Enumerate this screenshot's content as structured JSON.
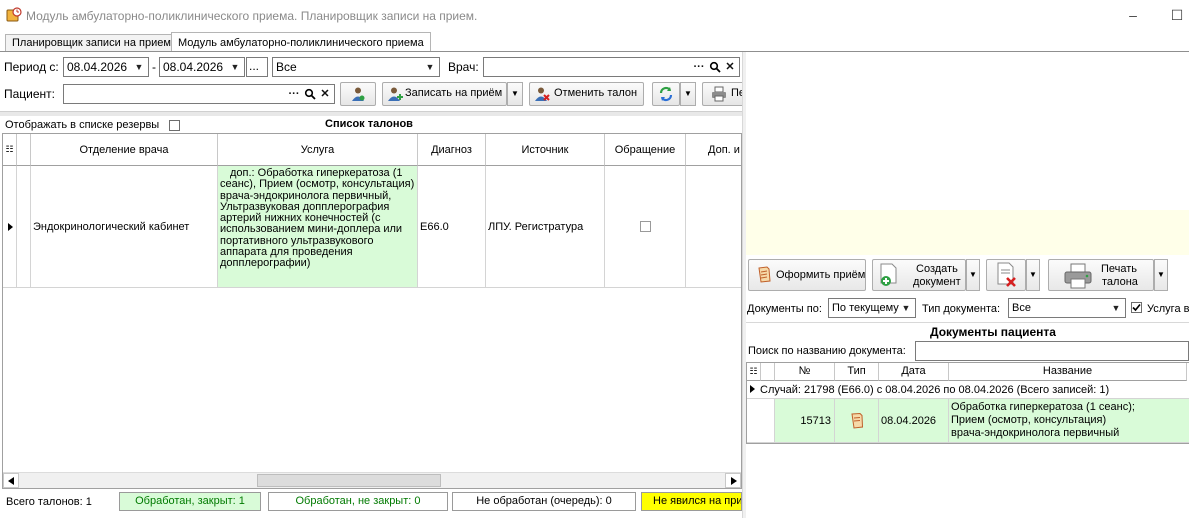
{
  "window": {
    "title": "Модуль амбулаторно-поликлинического приема. Планировщик записи на прием.",
    "minimize_glyph": "–",
    "maximize_glyph": "☐"
  },
  "tabs": [
    {
      "label": "Планировщик записи на прием",
      "active": false
    },
    {
      "label": "Модуль амбулаторно-поликлинического приема",
      "active": true
    }
  ],
  "filters": {
    "period_label": "Период с:",
    "date_from": "08.04.2026",
    "date_sep": "-",
    "date_to": "08.04.2026",
    "ellipsis": "...",
    "status_value": "Все",
    "doctor_label": "Врач:",
    "doctor_value": "",
    "patient_label": "Пациент:",
    "patient_value": ""
  },
  "toolbar": {
    "book_label": "Записать на приём",
    "cancel_label": "Отменить талон",
    "print_label": "Пе"
  },
  "list": {
    "reserves_label": "Отображать в списке резервы",
    "title": "Список талонов",
    "columns": [
      "Отделение врача",
      "Услуга",
      "Диагноз",
      "Источник",
      "Обращение",
      "Доп. и"
    ],
    "rows": [
      {
        "department": "Эндокринологический кабинет",
        "service": "доп.: Обработка гиперкератоза (1 сеанс), Прием (осмотр, консультация) врача-эндокринолога первичный, Ультразвуковая допплерография артерий нижних конечностей (с использованием мини-доплера или портативного ультразвукового аппарата для проведения допплерографии)",
        "diagnosis": "E66.0",
        "source": "ЛПУ. Регистратура"
      }
    ]
  },
  "statusbar": {
    "total": "Всего талонов: 1",
    "processed_closed": "Обработан, закрыт: 1",
    "processed_open": "Обработан, не закрыт: 0",
    "not_processed": "Не обработан (очередь): 0",
    "no_show": "Не явился на при"
  },
  "right_panel": {
    "buttons": {
      "issue": "Оформить приём",
      "create_doc_line1": "Создать",
      "create_doc_line2": "документ",
      "print_ticket_line1": "Печать",
      "print_ticket_line2": "талона"
    },
    "docs_by_label": "Документы по:",
    "docs_by_value": "По текущему",
    "doc_type_label": "Тип документа:",
    "doc_type_value": "Все",
    "service_in_label": "Услуга в",
    "docs_title": "Документы пациента",
    "search_label": "Поиск по названию документа:",
    "search_value": "",
    "columns": [
      "№",
      "Тип",
      "Дата",
      "Название"
    ],
    "group_row": "Случай: 21798 (E66.0) с 08.04.2026  по 08.04.2026 (Всего записей: 1)",
    "docs": [
      {
        "num": "15713",
        "date": "08.04.2026",
        "name_line1": "Обработка гиперкератоза (1 сеанс);",
        "name_line2": "Прием (осмотр, консультация)",
        "name_line3": "врача-эндокринолога первичный"
      }
    ]
  },
  "colors": {
    "processed_green": "#d9fbd8",
    "no_show_yellow": "#ffff00",
    "preview_yellow": "#ffffe9",
    "accent_text_green": "#007a00"
  }
}
